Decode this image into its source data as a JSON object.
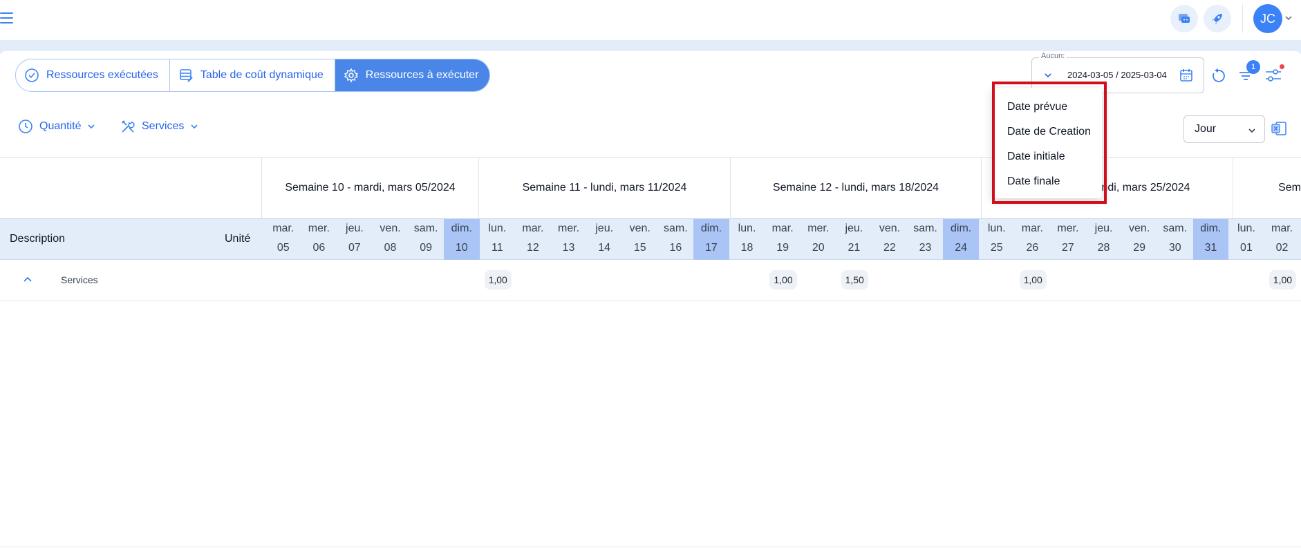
{
  "topbar": {
    "menu_icon": "hamburger-icon",
    "chat_icon": "chat-icon",
    "rocket_icon": "rocket-icon",
    "avatar_initials": "JC"
  },
  "tabs": [
    {
      "label": "Ressources exécutées",
      "icon": "check-circle-icon",
      "active": false
    },
    {
      "label": "Table de coût dynamique",
      "icon": "table-edit-icon",
      "active": false
    },
    {
      "label": "Ressources à exécuter",
      "icon": "gear-icon",
      "active": true
    }
  ],
  "date_range": {
    "label": "Aucun:",
    "value": "2024-03-05 / 2025-03-04"
  },
  "filter_badge": "1",
  "filters": {
    "quantity_label": "Quantité",
    "services_label": "Services"
  },
  "view_select": "Jour",
  "date_type_menu": [
    "Date prévue",
    "Date de Creation",
    "Date initiale",
    "Date finale"
  ],
  "table": {
    "col_description": "Description",
    "col_unit": "Unité",
    "weeks": [
      "Semaine 10 - mardi, mars 05/2024",
      "Semaine 11 - lundi, mars 11/2024",
      "Semaine 12 - lundi, mars 18/2024",
      "Semaine 13 - lundi, mars 25/2024",
      "Sem"
    ],
    "days": [
      {
        "name": "mar.",
        "num": "05",
        "sunday": false
      },
      {
        "name": "mer.",
        "num": "06",
        "sunday": false
      },
      {
        "name": "jeu.",
        "num": "07",
        "sunday": false
      },
      {
        "name": "ven.",
        "num": "08",
        "sunday": false
      },
      {
        "name": "sam.",
        "num": "09",
        "sunday": false
      },
      {
        "name": "dim.",
        "num": "10",
        "sunday": true
      },
      {
        "name": "lun.",
        "num": "11",
        "sunday": false
      },
      {
        "name": "mar.",
        "num": "12",
        "sunday": false
      },
      {
        "name": "mer.",
        "num": "13",
        "sunday": false
      },
      {
        "name": "jeu.",
        "num": "14",
        "sunday": false
      },
      {
        "name": "ven.",
        "num": "15",
        "sunday": false
      },
      {
        "name": "sam.",
        "num": "16",
        "sunday": false
      },
      {
        "name": "dim.",
        "num": "17",
        "sunday": true
      },
      {
        "name": "lun.",
        "num": "18",
        "sunday": false
      },
      {
        "name": "mar.",
        "num": "19",
        "sunday": false
      },
      {
        "name": "mer.",
        "num": "20",
        "sunday": false
      },
      {
        "name": "jeu.",
        "num": "21",
        "sunday": false
      },
      {
        "name": "ven.",
        "num": "22",
        "sunday": false
      },
      {
        "name": "sam.",
        "num": "23",
        "sunday": false
      },
      {
        "name": "dim.",
        "num": "24",
        "sunday": true
      },
      {
        "name": "lun.",
        "num": "25",
        "sunday": false
      },
      {
        "name": "mar.",
        "num": "26",
        "sunday": false
      },
      {
        "name": "mer.",
        "num": "27",
        "sunday": false
      },
      {
        "name": "jeu.",
        "num": "28",
        "sunday": false
      },
      {
        "name": "ven.",
        "num": "29",
        "sunday": false
      },
      {
        "name": "sam.",
        "num": "30",
        "sunday": false
      },
      {
        "name": "dim.",
        "num": "31",
        "sunday": true
      },
      {
        "name": "lun.",
        "num": "01",
        "sunday": false
      },
      {
        "name": "mar.",
        "num": "02",
        "sunday": false
      }
    ],
    "rows": [
      {
        "label": "Services",
        "values": [
          {
            "day": "11",
            "value": "1,00"
          },
          {
            "day": "19",
            "value": "1,00"
          },
          {
            "day": "21",
            "value": "1,50"
          },
          {
            "day": "26",
            "value": "1,00"
          },
          {
            "day": "02",
            "value": "1,00"
          }
        ]
      }
    ]
  }
}
